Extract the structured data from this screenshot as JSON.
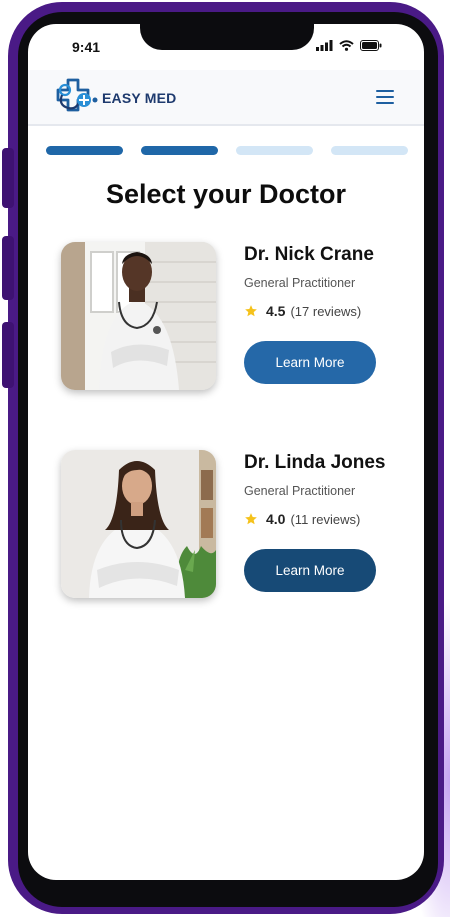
{
  "status": {
    "time": "9:41"
  },
  "app": {
    "brand": "EASY MED"
  },
  "progress": {
    "steps": 4,
    "completed": 2,
    "active_color": "#1f67a8",
    "inactive_color": "#d3e6f6"
  },
  "page": {
    "title": "Select your Doctor"
  },
  "doctors": [
    {
      "name": "Dr. Nick Crane",
      "specialty": "General Practitioner",
      "rating": "4.5",
      "reviews": "(17 reviews)",
      "button": "Learn More",
      "button_color": "#2568a8"
    },
    {
      "name": "Dr. Linda Jones",
      "specialty": "General Practitioner",
      "rating": "4.0",
      "reviews": "(11 reviews)",
      "button": "Learn More",
      "button_color": "#174a76"
    }
  ],
  "colors": {
    "phone_frame": "#4a1a86",
    "star": "#f5c21b",
    "brand": "#1e3a6e"
  },
  "icons": [
    "signal-icon",
    "wifi-icon",
    "battery-icon",
    "logo-icon",
    "menu-icon",
    "star-icon"
  ]
}
